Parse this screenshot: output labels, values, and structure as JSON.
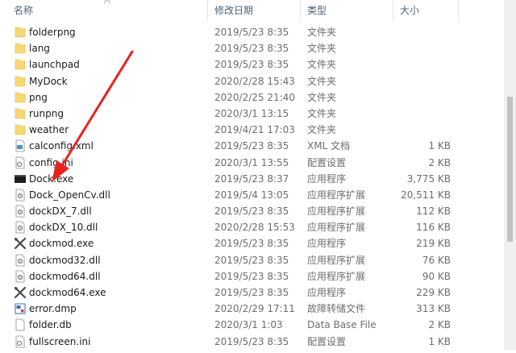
{
  "header": {
    "name": "名称",
    "date": "修改日期",
    "type": "类型",
    "size": "大小"
  },
  "files": [
    {
      "name": "folderpng",
      "date": "2019/5/23 8:35",
      "type": "文件夹",
      "size": "",
      "icon": "folder-icon"
    },
    {
      "name": "lang",
      "date": "2019/5/23 8:35",
      "type": "文件夹",
      "size": "",
      "icon": "folder-icon"
    },
    {
      "name": "launchpad",
      "date": "2019/5/23 8:35",
      "type": "文件夹",
      "size": "",
      "icon": "folder-icon"
    },
    {
      "name": "MyDock",
      "date": "2020/2/28 15:43",
      "type": "文件夹",
      "size": "",
      "icon": "folder-icon"
    },
    {
      "name": "png",
      "date": "2020/2/25 21:40",
      "type": "文件夹",
      "size": "",
      "icon": "folder-icon"
    },
    {
      "name": "runpng",
      "date": "2020/3/1 13:15",
      "type": "文件夹",
      "size": "",
      "icon": "folder-icon"
    },
    {
      "name": "weather",
      "date": "2019/4/21 17:03",
      "type": "文件夹",
      "size": "",
      "icon": "folder-icon"
    },
    {
      "name": "calconfig.xml",
      "date": "2019/5/23 8:35",
      "type": "XML 文档",
      "size": "1 KB",
      "icon": "xml-file-icon"
    },
    {
      "name": "config.ini",
      "date": "2020/3/1 13:55",
      "type": "配置设置",
      "size": "2 KB",
      "icon": "ini-file-icon"
    },
    {
      "name": "Dock.exe",
      "date": "2019/5/23 8:37",
      "type": "应用程序",
      "size": "3,775 KB",
      "icon": "exe-window-icon"
    },
    {
      "name": "Dock_OpenCv.dll",
      "date": "2019/5/4 13:05",
      "type": "应用程序扩展",
      "size": "20,511 KB",
      "icon": "dll-file-icon"
    },
    {
      "name": "dockDX_7.dll",
      "date": "2019/5/23 8:35",
      "type": "应用程序扩展",
      "size": "112 KB",
      "icon": "dll-file-icon"
    },
    {
      "name": "dockDX_10.dll",
      "date": "2020/2/28 15:53",
      "type": "应用程序扩展",
      "size": "116 KB",
      "icon": "dll-file-icon"
    },
    {
      "name": "dockmod.exe",
      "date": "2019/5/23 8:35",
      "type": "应用程序",
      "size": "219 KB",
      "icon": "tools-exe-icon"
    },
    {
      "name": "dockmod32.dll",
      "date": "2019/5/23 8:35",
      "type": "应用程序扩展",
      "size": "76 KB",
      "icon": "dll-file-icon"
    },
    {
      "name": "dockmod64.dll",
      "date": "2019/5/23 8:35",
      "type": "应用程序扩展",
      "size": "90 KB",
      "icon": "dll-file-icon"
    },
    {
      "name": "dockmod64.exe",
      "date": "2019/5/23 8:35",
      "type": "应用程序",
      "size": "229 KB",
      "icon": "tools-exe-icon"
    },
    {
      "name": "error.dmp",
      "date": "2020/2/29 17:11",
      "type": "故障转储文件",
      "size": "313 KB",
      "icon": "dmp-file-icon"
    },
    {
      "name": "folder.db",
      "date": "2020/3/1 1:03",
      "type": "Data Base File",
      "size": "2 KB",
      "icon": "db-file-icon"
    },
    {
      "name": "fullscreen.ini",
      "date": "2019/5/23 8:35",
      "type": "配置设置",
      "size": "1 KB",
      "icon": "ini-file-icon"
    }
  ],
  "colors": {
    "folder": "#f8d775",
    "header_text": "#4c607a",
    "annotation_arrow": "#e8231f"
  }
}
